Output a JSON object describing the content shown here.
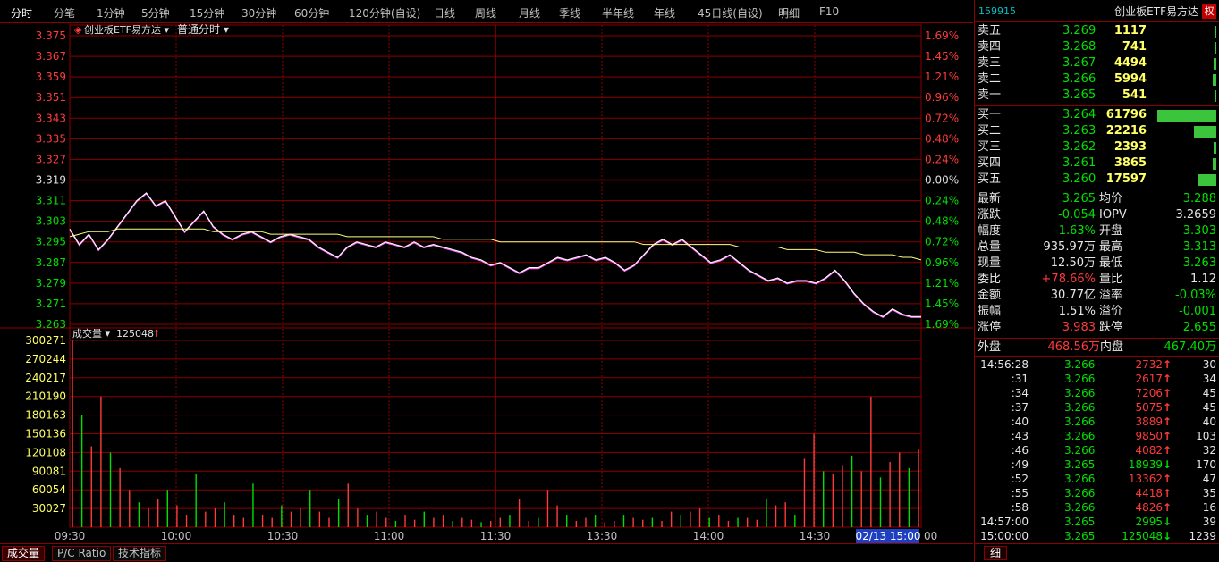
{
  "toolbar": {
    "items": [
      "分时",
      "分笔",
      "1分钟",
      "5分钟",
      "15分钟",
      "30分钟",
      "60分钟",
      "120分钟(自设)",
      "日线",
      "周线",
      "月线",
      "季线",
      "半年线",
      "年线",
      "45日线(自设)",
      "明细",
      "F10"
    ],
    "active_index": 0
  },
  "chart_header": {
    "name": "创业板ETF易方达",
    "mode": "普通分时"
  },
  "volume_header": {
    "label": "成交量",
    "value": "125048",
    "arrow": "↑"
  },
  "time_cursor": "02/13 15:00",
  "time_cursor_suffix": "00",
  "bottom_tabs": [
    "成交量",
    "P/C Ratio",
    "技术指标"
  ],
  "right_bottom_tab": "细",
  "colors": {
    "up": "#ff3b3b",
    "down": "#00e000",
    "grid": "#8b0000",
    "price_line": "#ffffff",
    "avg_line": "#ffff80"
  },
  "chart_data": [
    {
      "type": "line",
      "x_ticks": [
        "09:30",
        "10:00",
        "10:30",
        "11:00",
        "11:30",
        "13:30",
        "14:00",
        "14:30"
      ],
      "y_left_ticks": [
        "3.375",
        "3.367",
        "3.359",
        "3.351",
        "3.343",
        "3.335",
        "3.327",
        "3.319",
        "3.311",
        "3.303",
        "3.295",
        "3.287",
        "3.279",
        "3.271",
        "3.263"
      ],
      "y_right_ticks": [
        "1.69%",
        "1.45%",
        "1.21%",
        "0.96%",
        "0.72%",
        "0.48%",
        "0.24%",
        "0.00%",
        "0.24%",
        "0.48%",
        "0.72%",
        "0.96%",
        "1.21%",
        "1.45%",
        "1.69%"
      ],
      "ylim": [
        3.263,
        3.375
      ],
      "x_range_minutes": [
        0,
        240
      ],
      "series": [
        {
          "values": [
            3.3,
            3.294,
            3.298,
            3.292,
            3.296,
            3.301,
            3.306,
            3.311,
            3.314,
            3.309,
            3.311,
            3.305,
            3.299,
            3.303,
            3.307,
            3.301,
            3.298,
            3.296,
            3.298,
            3.299,
            3.297,
            3.295,
            3.297,
            3.298,
            3.297,
            3.296,
            3.293,
            3.291,
            3.289,
            3.293,
            3.295,
            3.294,
            3.293,
            3.295,
            3.294,
            3.293,
            3.295,
            3.293,
            3.294,
            3.293,
            3.292,
            3.291,
            3.289,
            3.288,
            3.286,
            3.287,
            3.285,
            3.283,
            3.285,
            3.285,
            3.287,
            3.289,
            3.288,
            3.289,
            3.29,
            3.288,
            3.289,
            3.287,
            3.284,
            3.286,
            3.29,
            3.294,
            3.296,
            3.294,
            3.296,
            3.293,
            3.29,
            3.287,
            3.288,
            3.29,
            3.287,
            3.284,
            3.282,
            3.28,
            3.281,
            3.279,
            3.28,
            3.28,
            3.279,
            3.281,
            3.284,
            3.28,
            3.275,
            3.271,
            3.268,
            3.266,
            3.269,
            3.267,
            3.266,
            3.266
          ]
        },
        {
          "values": [
            3.297,
            3.298,
            3.299,
            3.299,
            3.299,
            3.3,
            3.3,
            3.3,
            3.3,
            3.3,
            3.3,
            3.3,
            3.3,
            3.3,
            3.3,
            3.299,
            3.299,
            3.299,
            3.299,
            3.299,
            3.299,
            3.298,
            3.298,
            3.298,
            3.298,
            3.298,
            3.298,
            3.298,
            3.298,
            3.297,
            3.297,
            3.297,
            3.297,
            3.297,
            3.297,
            3.297,
            3.297,
            3.297,
            3.297,
            3.296,
            3.296,
            3.296,
            3.296,
            3.296,
            3.296,
            3.295,
            3.295,
            3.295,
            3.295,
            3.295,
            3.295,
            3.295,
            3.295,
            3.295,
            3.295,
            3.295,
            3.295,
            3.295,
            3.295,
            3.295,
            3.294,
            3.294,
            3.294,
            3.294,
            3.294,
            3.294,
            3.294,
            3.294,
            3.294,
            3.294,
            3.293,
            3.293,
            3.293,
            3.293,
            3.293,
            3.292,
            3.292,
            3.292,
            3.292,
            3.291,
            3.291,
            3.291,
            3.291,
            3.29,
            3.29,
            3.29,
            3.29,
            3.289,
            3.289,
            3.288
          ]
        }
      ]
    },
    {
      "type": "bar",
      "y_ticks": [
        "300271",
        "270244",
        "240217",
        "210190",
        "180163",
        "150136",
        "120108",
        "90081",
        "60054",
        "30027"
      ],
      "ylim": [
        0,
        300271
      ],
      "values": [
        300271,
        180000,
        130000,
        210000,
        120000,
        95000,
        60000,
        40000,
        30000,
        45000,
        60000,
        35000,
        20000,
        85000,
        25000,
        30000,
        40000,
        20000,
        15000,
        70000,
        20000,
        15000,
        35000,
        25000,
        30000,
        60000,
        25000,
        15000,
        45000,
        70000,
        30000,
        20000,
        25000,
        15000,
        10000,
        20000,
        12000,
        25000,
        15000,
        20000,
        10000,
        15000,
        12000,
        8000,
        10000,
        15000,
        20000,
        45000,
        10000,
        15000,
        60000,
        35000,
        20000,
        10000,
        15000,
        20000,
        8000,
        10000,
        20000,
        15000,
        12000,
        15000,
        10000,
        25000,
        20000,
        25000,
        30000,
        15000,
        20000,
        10000,
        15000,
        15000,
        12000,
        45000,
        35000,
        40000,
        20000,
        110000,
        150000,
        90000,
        85000,
        100000,
        115000,
        90000,
        210000,
        80000,
        105000,
        120000,
        95000,
        125048
      ]
    }
  ],
  "order_book": {
    "code": "159915",
    "name": "创业板ETF易方达",
    "badge": "权",
    "sells": [
      {
        "label": "卖五",
        "price": "3.269",
        "vol": "1117",
        "bar": 0.02
      },
      {
        "label": "卖四",
        "price": "3.268",
        "vol": "741",
        "bar": 0.015
      },
      {
        "label": "卖三",
        "price": "3.267",
        "vol": "4494",
        "bar": 0.05
      },
      {
        "label": "卖二",
        "price": "3.266",
        "vol": "5994",
        "bar": 0.06
      },
      {
        "label": "卖一",
        "price": "3.265",
        "vol": "541",
        "bar": 0.012
      }
    ],
    "buys": [
      {
        "label": "买一",
        "price": "3.264",
        "vol": "61796",
        "bar": 1.0
      },
      {
        "label": "买二",
        "price": "3.263",
        "vol": "22216",
        "bar": 0.38
      },
      {
        "label": "买三",
        "price": "3.262",
        "vol": "2393",
        "bar": 0.04
      },
      {
        "label": "买四",
        "price": "3.261",
        "vol": "3865",
        "bar": 0.065
      },
      {
        "label": "买五",
        "price": "3.260",
        "vol": "17597",
        "bar": 0.3
      }
    ]
  },
  "stats": [
    {
      "l1": "最新",
      "v1": "3.265",
      "c1": "green",
      "l2": "均价",
      "v2": "3.288",
      "c2": "green"
    },
    {
      "l1": "涨跌",
      "v1": "-0.054",
      "c1": "green",
      "l2": "IOPV",
      "v2": "3.2659",
      "c2": "white"
    },
    {
      "l1": "幅度",
      "v1": "-1.63%",
      "c1": "green",
      "l2": "开盘",
      "v2": "3.303",
      "c2": "green"
    },
    {
      "l1": "总量",
      "v1": "935.97万",
      "c1": "white",
      "l2": "最高",
      "v2": "3.313",
      "c2": "green"
    },
    {
      "l1": "现量",
      "v1": "12.50万",
      "c1": "white",
      "l2": "最低",
      "v2": "3.263",
      "c2": "green"
    },
    {
      "l1": "委比",
      "v1": "+78.66%",
      "c1": "red",
      "l2": "量比",
      "v2": "1.12",
      "c2": "white"
    },
    {
      "l1": "金额",
      "v1": "30.77亿",
      "c1": "white",
      "l2": "溢率",
      "v2": "-0.03%",
      "c2": "green"
    },
    {
      "l1": "振幅",
      "v1": "1.51%",
      "c1": "white",
      "l2": "溢价",
      "v2": "-0.001",
      "c2": "green"
    },
    {
      "l1": "涨停",
      "v1": "3.983",
      "c1": "red",
      "l2": "跌停",
      "v2": "2.655",
      "c2": "green"
    }
  ],
  "outer_inner": {
    "outer_label": "外盘",
    "outer_value": "468.56万",
    "inner_label": "内盘",
    "inner_value": "467.40万"
  },
  "ticks": [
    {
      "time": "14:56:28",
      "price": "3.266",
      "vol": "2732",
      "dir": "↑",
      "n": "30"
    },
    {
      "time": ":31",
      "price": "3.266",
      "vol": "2617",
      "dir": "↑",
      "n": "34"
    },
    {
      "time": ":34",
      "price": "3.266",
      "vol": "7206",
      "dir": "↑",
      "n": "45"
    },
    {
      "time": ":37",
      "price": "3.266",
      "vol": "5075",
      "dir": "↑",
      "n": "45"
    },
    {
      "time": ":40",
      "price": "3.266",
      "vol": "3889",
      "dir": "↑",
      "n": "40"
    },
    {
      "time": ":43",
      "price": "3.266",
      "vol": "9850",
      "dir": "↑",
      "n": "103"
    },
    {
      "time": ":46",
      "price": "3.266",
      "vol": "4082",
      "dir": "↑",
      "n": "32"
    },
    {
      "time": ":49",
      "price": "3.265",
      "vol": "18939",
      "dir": "↓",
      "n": "170"
    },
    {
      "time": ":52",
      "price": "3.266",
      "vol": "13362",
      "dir": "↑",
      "n": "47"
    },
    {
      "time": ":55",
      "price": "3.266",
      "vol": "4418",
      "dir": "↑",
      "n": "35"
    },
    {
      "time": ":58",
      "price": "3.266",
      "vol": "4826",
      "dir": "↑",
      "n": "16"
    },
    {
      "time": "14:57:00",
      "price": "3.265",
      "vol": "2995",
      "dir": "↓",
      "n": "39"
    },
    {
      "time": "15:00:00",
      "price": "3.265",
      "vol": "125048",
      "dir": "↓",
      "n": "1239"
    }
  ]
}
